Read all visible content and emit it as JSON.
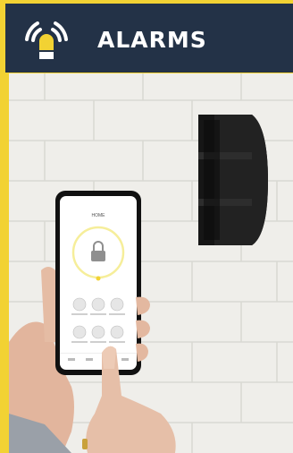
{
  "header": {
    "title": "ALARMS",
    "icon": "siren-light-icon",
    "bg_color": "#233247",
    "accent_color": "#f2d233"
  },
  "photo": {
    "description_icon": "smartphone-security-app-photo",
    "phone_screen": {
      "title": "HOME"
    }
  }
}
